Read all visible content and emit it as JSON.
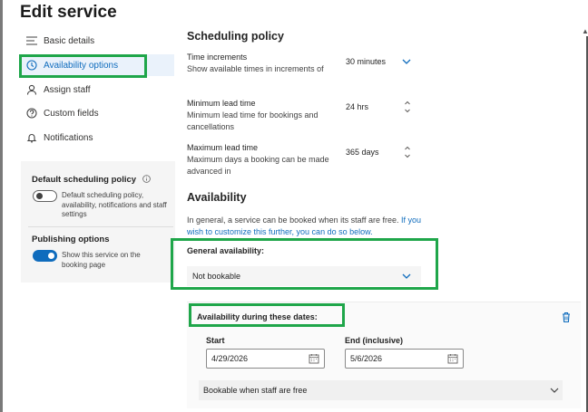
{
  "page": {
    "title": "Edit service"
  },
  "sidebar": {
    "items": [
      {
        "label": "Basic details",
        "icon": "list-icon"
      },
      {
        "label": "Availability options",
        "icon": "clock-icon",
        "active": true
      },
      {
        "label": "Assign staff",
        "icon": "person-icon"
      },
      {
        "label": "Custom fields",
        "icon": "question-icon"
      },
      {
        "label": "Notifications",
        "icon": "bell-icon"
      }
    ],
    "default_policy": {
      "title": "Default scheduling policy",
      "description": "Default scheduling policy, availability, notifications and staff settings",
      "enabled": false
    },
    "publishing": {
      "title": "Publishing options",
      "description": "Show this service on the booking page",
      "enabled": true
    }
  },
  "scheduling": {
    "heading": "Scheduling policy",
    "time_increments": {
      "title": "Time increments",
      "desc": "Show available times in increments of",
      "value": "30 minutes"
    },
    "min_lead": {
      "title": "Minimum lead time",
      "desc": "Minimum lead time for bookings and cancellations",
      "value": "24 hrs"
    },
    "max_lead": {
      "title": "Maximum lead time",
      "desc": "Maximum days a booking can be made advanced in",
      "value": "365 days"
    }
  },
  "availability": {
    "heading": "Availability",
    "intro_plain": "In general, a service can be booked when its staff are free.",
    "intro_link": "If you wish to customize this further, you can do so below.",
    "general_label": "General availability:",
    "general_value": "Not bookable",
    "dates": {
      "label": "Availability during these dates:",
      "start_label": "Start",
      "start_value": "4/29/2026",
      "end_label": "End (inclusive)",
      "end_value": "5/6/2026",
      "mode": "Bookable when staff are free"
    }
  },
  "colors": {
    "accent": "#0f6cbd",
    "highlight": "#1fa64a",
    "active_bg": "#eaf2fb"
  }
}
